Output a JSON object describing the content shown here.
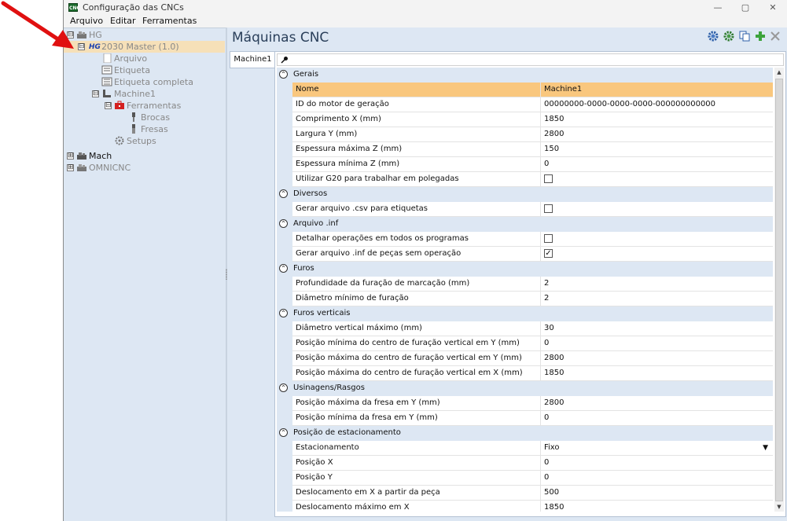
{
  "window": {
    "app_icon_text": "CNC",
    "title": "Configuração das CNCs",
    "controls": {
      "minimize": "—",
      "maximize": "▢",
      "close": "✕"
    }
  },
  "menu": [
    "Arquivo",
    "Editar",
    "Ferramentas"
  ],
  "tree": [
    {
      "label": "HG",
      "expander": "⊟",
      "level": 0
    },
    {
      "label": "2030 Master (1.0)",
      "expander": "⊟",
      "level": 1,
      "selected": true
    },
    {
      "label": "Arquivo",
      "level": 2
    },
    {
      "label": "Etiqueta",
      "level": 2
    },
    {
      "label": "Etiqueta completa",
      "level": 2
    },
    {
      "label": "Machine1",
      "expander": "⊟",
      "level": 2
    },
    {
      "label": "Ferramentas",
      "expander": "⊟",
      "level": 3
    },
    {
      "label": "Brocas",
      "level": 4
    },
    {
      "label": "Fresas",
      "level": 4
    },
    {
      "label": "Setups",
      "level": 3
    },
    {
      "label": "Mach",
      "expander": "⊞",
      "level": 0
    },
    {
      "label": "OMNICNC",
      "expander": "⊞",
      "level": 0
    }
  ],
  "main": {
    "title": "Máquinas CNC",
    "tab": "Machine1",
    "search_icon": "key-icon",
    "toolbar_icons": [
      "gear-blue-icon",
      "gear-green-icon",
      "copy-icon",
      "add-icon",
      "delete-icon"
    ]
  },
  "grid": {
    "categories": [
      {
        "label": "Gerais",
        "rows": [
          {
            "name": "Nome",
            "value": "Machine1",
            "highlight": true
          },
          {
            "name": "ID do motor de geração",
            "value": "00000000-0000-0000-0000-000000000000"
          },
          {
            "name": "Comprimento X (mm)",
            "value": "1850"
          },
          {
            "name": "Largura Y (mm)",
            "value": "2800"
          },
          {
            "name": "Espessura máxima Z (mm)",
            "value": "150"
          },
          {
            "name": "Espessura mínima Z (mm)",
            "value": "0"
          },
          {
            "name": "Utilizar G20 para trabalhar em polegadas",
            "checkbox": true,
            "checked": false
          }
        ]
      },
      {
        "label": "Diversos",
        "rows": [
          {
            "name": "Gerar arquivo .csv para etiquetas",
            "checkbox": true,
            "checked": false
          }
        ]
      },
      {
        "label": "Arquivo .inf",
        "rows": [
          {
            "name": "Detalhar operações em todos os programas",
            "checkbox": true,
            "checked": false
          },
          {
            "name": "Gerar arquivo .inf de peças sem operação",
            "checkbox": true,
            "checked": true
          }
        ]
      },
      {
        "label": "Furos",
        "rows": [
          {
            "name": "Profundidade da furação de marcação (mm)",
            "value": "2"
          },
          {
            "name": "Diâmetro mínimo de furação",
            "value": "2"
          }
        ]
      },
      {
        "label": "Furos verticais",
        "rows": [
          {
            "name": "Diâmetro vertical máximo (mm)",
            "value": "30"
          },
          {
            "name": "Posição mínima do centro de furação vertical em Y (mm)",
            "value": "0"
          },
          {
            "name": "Posição máxima do centro de furação vertical em Y (mm)",
            "value": "2800"
          },
          {
            "name": "Posição máxima do centro de furação vertical em X (mm)",
            "value": "1850"
          }
        ]
      },
      {
        "label": "Usinagens/Rasgos",
        "rows": [
          {
            "name": "Posição máxima da fresa em Y (mm)",
            "value": "2800"
          },
          {
            "name": "Posição mínima da fresa em Y (mm)",
            "value": "0"
          }
        ]
      },
      {
        "label": "Posição de estacionamento",
        "rows": [
          {
            "name": "Estacionamento",
            "value": "Fixo",
            "dropdown": true
          },
          {
            "name": "Posição X",
            "value": "0"
          },
          {
            "name": "Posição Y",
            "value": "0"
          },
          {
            "name": "Deslocamento em X a partir da peça",
            "value": "500"
          },
          {
            "name": "Deslocamento máximo em X",
            "value": "1850"
          }
        ]
      }
    ]
  },
  "colors": {
    "panel_bg": "#dde7f3",
    "selection": "#f6e0b8",
    "highlight_row": "#f9c77e",
    "annotation_arrow": "#e01010"
  }
}
